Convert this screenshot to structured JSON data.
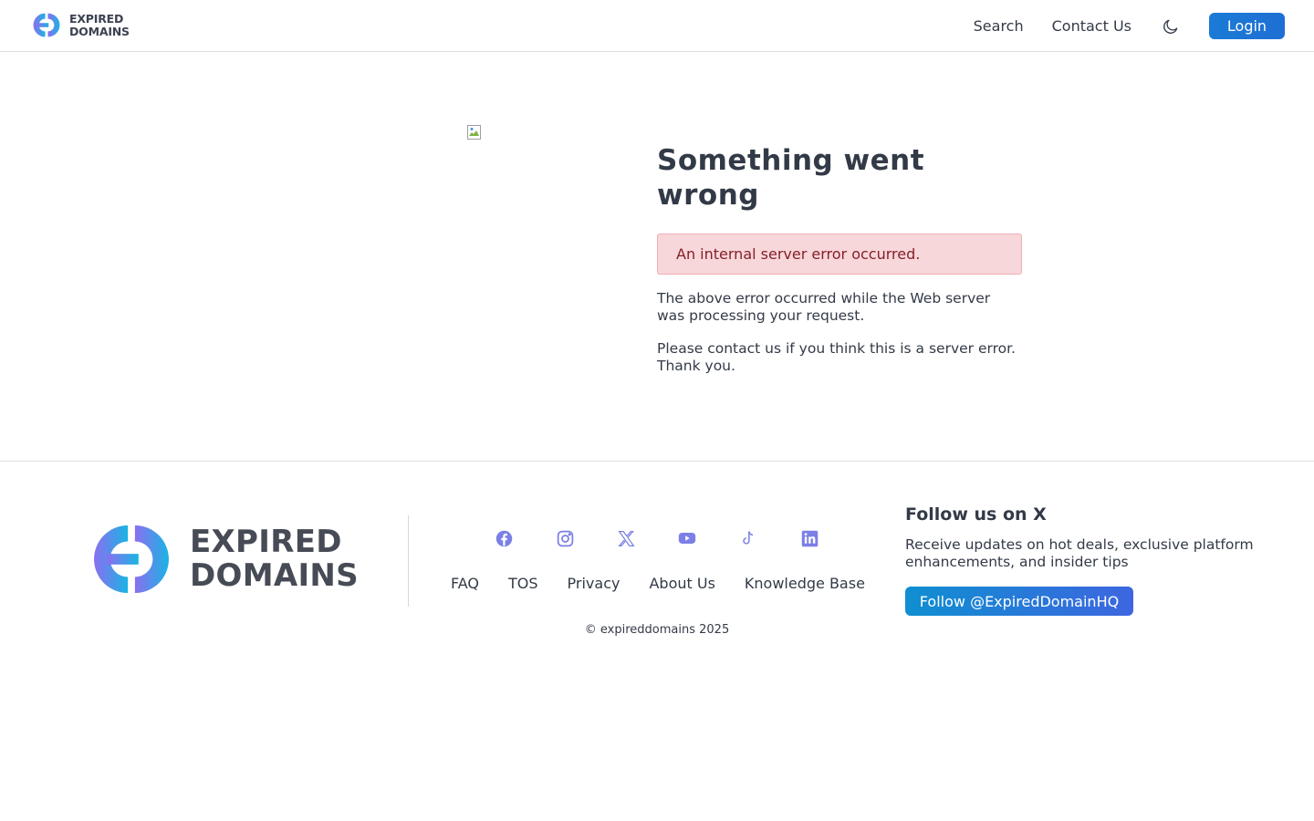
{
  "header": {
    "logo_line1": "EXPIRED",
    "logo_line2": "DOMAINS",
    "nav": {
      "search": "Search",
      "contact": "Contact Us",
      "login": "Login"
    },
    "theme_icon": "moon-icon"
  },
  "main": {
    "title": "Something went wrong",
    "alert": "An internal server error occurred.",
    "paragraph1": "The above error occurred while the Web server was processing your request.",
    "paragraph2": "Please contact us if you think this is a server error. Thank you."
  },
  "footer": {
    "logo_line1": "EXPIRED",
    "logo_line2": "DOMAINS",
    "social_icons": [
      "facebook-icon",
      "instagram-icon",
      "x-icon",
      "youtube-icon",
      "tiktok-icon",
      "linkedin-icon"
    ],
    "links": {
      "faq": "FAQ",
      "tos": "TOS",
      "privacy": "Privacy",
      "about": "About Us",
      "kb": "Knowledge Base"
    },
    "copyright": "© expireddomains 2025",
    "follow": {
      "heading": "Follow us on X",
      "text": "Receive updates on hot deals, exclusive platform enhancements, and insider tips",
      "button": "Follow @ExpiredDomainHQ"
    }
  },
  "colors": {
    "brand_blue": "#1976d2",
    "icon_purple": "#7b7fe6",
    "alert_bg": "#f8d7da",
    "alert_text": "#842029"
  }
}
